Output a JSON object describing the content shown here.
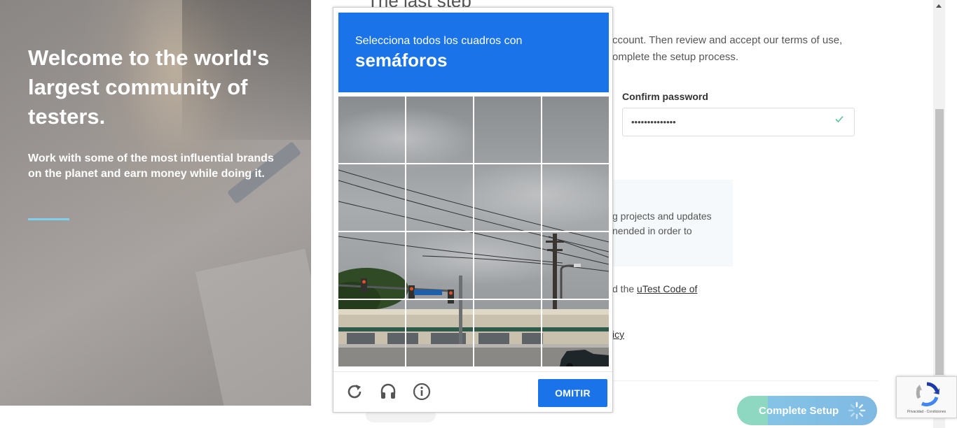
{
  "hero": {
    "heading": "Welcome to the world's largest community of testers.",
    "subtext": "Work with some of the most influential brands on the planet and earn money while doing it.",
    "accent_color": "#7fd0ea"
  },
  "form": {
    "title_fragment": "The last step",
    "intro_fragment": "ccount. Then review and accept our terms of use, omplete the setup process.",
    "confirm_password": {
      "label": "Confirm password",
      "value": "••••••••••••••",
      "valid_icon": "check-icon"
    },
    "info_fragment": "g projects and updates nended in order to",
    "code_prefix": "d the ",
    "code_link": "uTest Code of",
    "policy_fragment": "icy",
    "submit": {
      "label": "Complete Setup",
      "state": "loading",
      "colors": [
        "#8ed7c0",
        "#7fb9e2"
      ]
    }
  },
  "captcha": {
    "instruction": "Selecciona todos los cuadros con",
    "target_object": "semáforos",
    "grid_size": 4,
    "header_color": "#1a73e8",
    "footer_icons": [
      "reload-icon",
      "audio-icon",
      "info-icon"
    ],
    "skip_label": "OMITIR"
  },
  "recaptcha_badge": {
    "fine_print": "Privacidad - Condiciones"
  }
}
